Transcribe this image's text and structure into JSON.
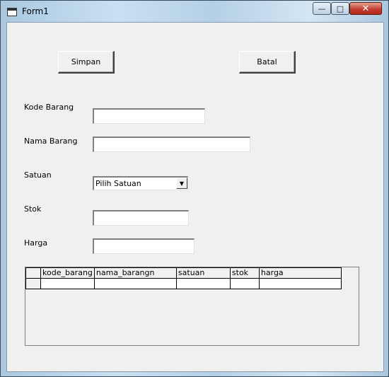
{
  "window": {
    "title": "Form1",
    "minimize_glyph": "—",
    "maximize_glyph": "□",
    "close_glyph": "✕"
  },
  "buttons": {
    "save_label": "Simpan",
    "cancel_label": "Batal"
  },
  "fields": {
    "kode_barang": {
      "label": "Kode Barang",
      "value": ""
    },
    "nama_barang": {
      "label": "Nama Barang",
      "value": ""
    },
    "satuan": {
      "label": "Satuan",
      "selected": "Pilih Satuan",
      "arrow": "▼"
    },
    "stok": {
      "label": "Stok",
      "value": ""
    },
    "harga": {
      "label": "Harga",
      "value": ""
    }
  },
  "grid": {
    "columns": [
      "kode_barang",
      "nama_barangn",
      "satuan",
      "stok",
      "harga"
    ]
  }
}
